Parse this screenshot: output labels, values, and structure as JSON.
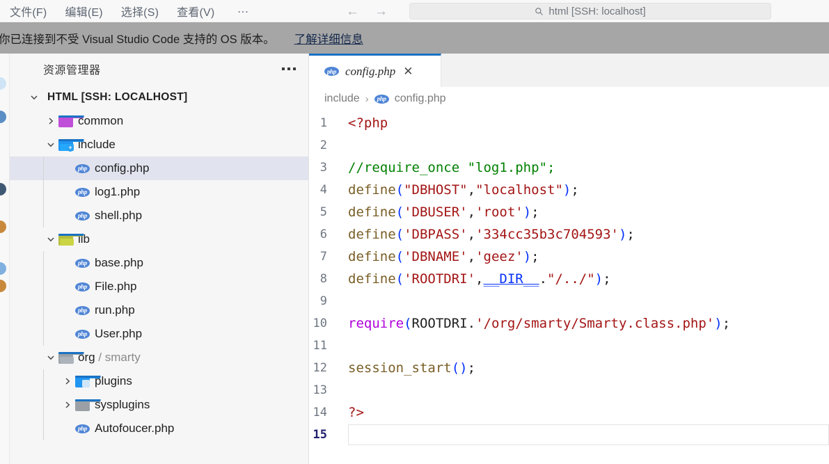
{
  "titlebar": {
    "menu": [
      {
        "label": "文件(F)",
        "name": "menu-file"
      },
      {
        "label": "编辑(E)",
        "name": "menu-edit"
      },
      {
        "label": "选择(S)",
        "name": "menu-selection"
      },
      {
        "label": "查看(V)",
        "name": "menu-view"
      }
    ],
    "more_label": "…",
    "back_arrow": "←",
    "forward_arrow": "→",
    "command_center": {
      "text": "html [SSH: localhost]",
      "icon": "search-icon"
    }
  },
  "banner": {
    "message": "你已连接到不受 Visual Studio Code 支持的 OS 版本。",
    "link": "了解详细信息",
    "background": "#a6a6a6"
  },
  "sidebar": {
    "title": "资源管理器",
    "more_label": "…",
    "root": {
      "label": "HTML [SSH: LOCALHOST]",
      "twisty": "chevron-down-icon"
    },
    "items": [
      {
        "name": "folder-common",
        "label": "common",
        "sub": "",
        "type": "folder",
        "twisty": "chevron-right-icon",
        "depth": 1,
        "icon": "folder-purple-icon",
        "color": "#bf4fd8",
        "badge": "",
        "selected": false
      },
      {
        "name": "folder-include",
        "label": "include",
        "sub": "",
        "type": "folder",
        "twisty": "chevron-down-icon",
        "depth": 1,
        "icon": "folder-blue-plus-icon",
        "color": "#2196f3",
        "badge": "+",
        "selected": false
      },
      {
        "name": "file-config-php",
        "label": "config.php",
        "sub": "",
        "type": "file",
        "twisty": "",
        "depth": 2,
        "icon": "php-icon",
        "color": "#4f85d6",
        "badge": "",
        "selected": true
      },
      {
        "name": "file-log1-php",
        "label": "log1.php",
        "sub": "",
        "type": "file",
        "twisty": "",
        "depth": 2,
        "icon": "php-icon",
        "color": "#4f85d6",
        "badge": "",
        "selected": false
      },
      {
        "name": "file-shell-php",
        "label": "shell.php",
        "sub": "",
        "type": "file",
        "twisty": "",
        "depth": 2,
        "icon": "php-icon",
        "color": "#4f85d6",
        "badge": "",
        "selected": false
      },
      {
        "name": "folder-lib",
        "label": "lib",
        "sub": "",
        "type": "folder",
        "twisty": "chevron-down-icon",
        "depth": 1,
        "icon": "folder-olive-icon",
        "color": "#b5bd3c",
        "badge": "",
        "selected": false
      },
      {
        "name": "file-base-php",
        "label": "base.php",
        "sub": "",
        "type": "file",
        "twisty": "",
        "depth": 2,
        "icon": "php-icon",
        "color": "#4f85d6",
        "badge": "",
        "selected": false
      },
      {
        "name": "file-file-php",
        "label": "File.php",
        "sub": "",
        "type": "file",
        "twisty": "",
        "depth": 2,
        "icon": "php-icon",
        "color": "#4f85d6",
        "badge": "",
        "selected": false
      },
      {
        "name": "file-run-php",
        "label": "run.php",
        "sub": "",
        "type": "file",
        "twisty": "",
        "depth": 2,
        "icon": "php-icon",
        "color": "#4f85d6",
        "badge": "",
        "selected": false
      },
      {
        "name": "file-user-php",
        "label": "User.php",
        "sub": "",
        "type": "file",
        "twisty": "",
        "depth": 2,
        "icon": "php-icon",
        "color": "#4f85d6",
        "badge": "",
        "selected": false
      },
      {
        "name": "folder-org-smarty",
        "label": "org",
        "sub": " / smarty",
        "type": "folder",
        "twisty": "chevron-down-icon",
        "depth": 1,
        "icon": "folder-gray-icon",
        "color": "#9aa0a6",
        "badge": "",
        "selected": false
      },
      {
        "name": "folder-plugins",
        "label": "plugins",
        "sub": "",
        "type": "folder",
        "twisty": "chevron-right-icon",
        "depth": 2,
        "icon": "folder-blue-plugin-icon",
        "color": "#2196f3",
        "badge": "",
        "selected": false
      },
      {
        "name": "folder-sysplugins",
        "label": "sysplugins",
        "sub": "",
        "type": "folder",
        "twisty": "chevron-right-icon",
        "depth": 2,
        "icon": "folder-gray-icon",
        "color": "#9aa0a6",
        "badge": "",
        "selected": false
      },
      {
        "name": "file-autofoucer-php",
        "label": "Autofoucer.php",
        "sub": "",
        "type": "file",
        "twisty": "",
        "depth": 2,
        "icon": "php-icon",
        "color": "#4f85d6",
        "badge": "",
        "selected": false
      }
    ]
  },
  "editor": {
    "tab": {
      "label": "config.php",
      "icon": "php-icon",
      "close_label": "✕",
      "active_border": "#1a72c4"
    },
    "breadcrumb": {
      "folder": "include",
      "separator": "›",
      "file": "config.php",
      "icon": "php-icon"
    },
    "lines": [
      {
        "no": "1",
        "active": false,
        "tokens": [
          {
            "t": "<?php",
            "c": "t-tag"
          }
        ]
      },
      {
        "no": "2",
        "active": false,
        "tokens": []
      },
      {
        "no": "3",
        "active": false,
        "tokens": [
          {
            "t": "//require_once \"log1.php\";",
            "c": "t-comment"
          }
        ]
      },
      {
        "no": "4",
        "active": false,
        "tokens": [
          {
            "t": "define",
            "c": "t-fn"
          },
          {
            "t": "(",
            "c": "t-paren"
          },
          {
            "t": "\"DBHOST\"",
            "c": "t-str"
          },
          {
            "t": ",",
            "c": "t-punc"
          },
          {
            "t": "\"localhost\"",
            "c": "t-str"
          },
          {
            "t": ")",
            "c": "t-paren"
          },
          {
            "t": ";",
            "c": "t-punc"
          }
        ]
      },
      {
        "no": "5",
        "active": false,
        "tokens": [
          {
            "t": "define",
            "c": "t-fn"
          },
          {
            "t": "(",
            "c": "t-paren"
          },
          {
            "t": "'DBUSER'",
            "c": "t-str"
          },
          {
            "t": ",",
            "c": "t-punc"
          },
          {
            "t": "'root'",
            "c": "t-str"
          },
          {
            "t": ")",
            "c": "t-paren"
          },
          {
            "t": ";",
            "c": "t-punc"
          }
        ]
      },
      {
        "no": "6",
        "active": false,
        "tokens": [
          {
            "t": "define",
            "c": "t-fn"
          },
          {
            "t": "(",
            "c": "t-paren"
          },
          {
            "t": "'DBPASS'",
            "c": "t-str"
          },
          {
            "t": ",",
            "c": "t-punc"
          },
          {
            "t": "'334cc35b3c704593'",
            "c": "t-str"
          },
          {
            "t": ")",
            "c": "t-paren"
          },
          {
            "t": ";",
            "c": "t-punc"
          }
        ]
      },
      {
        "no": "7",
        "active": false,
        "tokens": [
          {
            "t": "define",
            "c": "t-fn"
          },
          {
            "t": "(",
            "c": "t-paren"
          },
          {
            "t": "'DBNAME'",
            "c": "t-str"
          },
          {
            "t": ",",
            "c": "t-punc"
          },
          {
            "t": "'geez'",
            "c": "t-str"
          },
          {
            "t": ")",
            "c": "t-paren"
          },
          {
            "t": ";",
            "c": "t-punc"
          }
        ]
      },
      {
        "no": "8",
        "active": false,
        "tokens": [
          {
            "t": "define",
            "c": "t-fn"
          },
          {
            "t": "(",
            "c": "t-paren"
          },
          {
            "t": "'ROOTDRI'",
            "c": "t-str"
          },
          {
            "t": ",",
            "c": "t-punc"
          },
          {
            "t": "__DIR__",
            "c": "t-magic"
          },
          {
            "t": ".",
            "c": "t-punc"
          },
          {
            "t": "\"/../\"",
            "c": "t-str"
          },
          {
            "t": ")",
            "c": "t-paren"
          },
          {
            "t": ";",
            "c": "t-punc"
          }
        ]
      },
      {
        "no": "9",
        "active": false,
        "tokens": []
      },
      {
        "no": "10",
        "active": false,
        "tokens": [
          {
            "t": "require",
            "c": "t-kw"
          },
          {
            "t": "(",
            "c": "t-paren"
          },
          {
            "t": "ROOTDRI",
            "c": "t-const"
          },
          {
            "t": ".",
            "c": "t-punc"
          },
          {
            "t": "'/org/smarty/Smarty.class.php'",
            "c": "t-str"
          },
          {
            "t": ")",
            "c": "t-paren"
          },
          {
            "t": ";",
            "c": "t-punc"
          }
        ]
      },
      {
        "no": "11",
        "active": false,
        "tokens": []
      },
      {
        "no": "12",
        "active": false,
        "tokens": [
          {
            "t": "session_start",
            "c": "t-fn"
          },
          {
            "t": "()",
            "c": "t-paren"
          },
          {
            "t": ";",
            "c": "t-punc"
          }
        ]
      },
      {
        "no": "13",
        "active": false,
        "tokens": []
      },
      {
        "no": "14",
        "active": false,
        "tokens": [
          {
            "t": "?>",
            "c": "t-tag"
          }
        ]
      },
      {
        "no": "15",
        "active": true,
        "tokens": []
      }
    ]
  }
}
